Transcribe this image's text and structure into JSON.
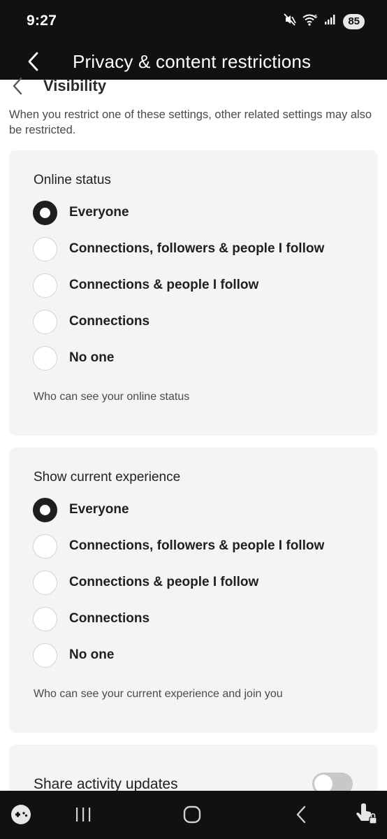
{
  "status_bar": {
    "time": "9:27",
    "battery": "85",
    "icons": [
      "mute-icon",
      "wifi-icon",
      "signal-icon"
    ]
  },
  "app_bar": {
    "title": "Privacy & content restrictions",
    "back_icon": "back-arrow-icon"
  },
  "section": {
    "title": "Visibility",
    "back_icon": "chevron-left-icon",
    "intro": "When you restrict one of these settings, other related settings may also be restricted."
  },
  "online_status": {
    "title": "Online status",
    "selected": "Everyone",
    "options": [
      {
        "label": "Everyone",
        "selected": true
      },
      {
        "label": "Connections, followers & people I follow",
        "selected": false
      },
      {
        "label": "Connections & people I follow",
        "selected": false
      },
      {
        "label": "Connections",
        "selected": false
      },
      {
        "label": "No one",
        "selected": false
      }
    ],
    "caption": "Who can see your online status"
  },
  "current_experience": {
    "title": "Show current experience",
    "selected": "Everyone",
    "options": [
      {
        "label": "Everyone",
        "selected": true
      },
      {
        "label": "Connections, followers & people I follow",
        "selected": false
      },
      {
        "label": "Connections & people I follow",
        "selected": false
      },
      {
        "label": "Connections",
        "selected": false
      },
      {
        "label": "No one",
        "selected": false
      }
    ],
    "caption": "Who can see your current experience and join you"
  },
  "activity": {
    "title": "Share activity updates",
    "enabled": false
  },
  "nav_bar": {
    "icons": [
      "game-controller-icon",
      "recents-icon",
      "home-icon",
      "back-icon",
      "touch-lock-icon"
    ]
  },
  "colors": {
    "bar_background": "#111111",
    "card_background": "#f4f4f4",
    "radio_selected": "#1e1e1e",
    "toggle_off": "#c8c8c8"
  }
}
